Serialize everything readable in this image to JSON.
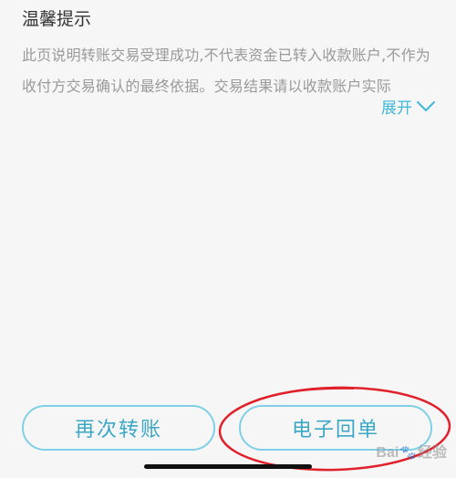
{
  "tips": {
    "title": "温馨提示",
    "body": "此页说明转账交易受理成功,不代表资金已转入收款账户,不作为收付方交易确认的最终依据。交易结果请以收款账户实际",
    "expand_label": "展开",
    "expand_icon": "chevron-down-icon"
  },
  "actions": {
    "transfer_again_label": "再次转账",
    "e_receipt_label": "电子回单"
  },
  "watermark": {
    "text_left": "Bai",
    "text_right": "经验"
  },
  "colors": {
    "accent": "#3aa7c6",
    "button_border": "#7fd0e6",
    "annotation": "#e0202a",
    "background": "#f6f6f6"
  }
}
